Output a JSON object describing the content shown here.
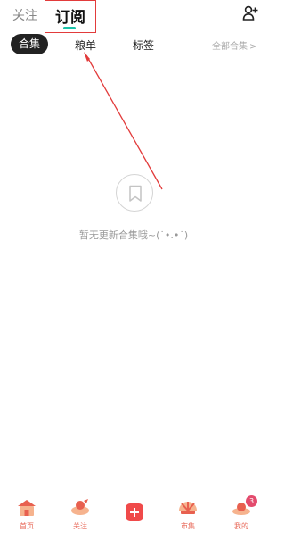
{
  "header": {
    "tabs": {
      "follow": "关注",
      "subscribe": "订阅"
    },
    "add_user_icon": "add-user-icon"
  },
  "subtabs": {
    "active": "合集",
    "items": [
      "粮单",
      "标签"
    ],
    "all_label": "全部合集",
    "chevron": ">"
  },
  "empty_state": {
    "icon": "bookmark-icon",
    "message": "暂无更新合集哦~(˙•.•˙)"
  },
  "bottom_nav": {
    "items": [
      {
        "label": "首页",
        "icon": "home-house-icon"
      },
      {
        "label": "关注",
        "icon": "follow-icon"
      },
      {
        "label": "",
        "icon": "add-plus-icon"
      },
      {
        "label": "市集",
        "icon": "market-icon"
      },
      {
        "label": "我的",
        "icon": "profile-icon"
      }
    ],
    "mine_badge": "3"
  },
  "colors": {
    "accent": "#19c3a8",
    "brand_red": "#f04a4a",
    "annotation_red": "#e23b3b",
    "nav_text": "#e86a5a"
  }
}
